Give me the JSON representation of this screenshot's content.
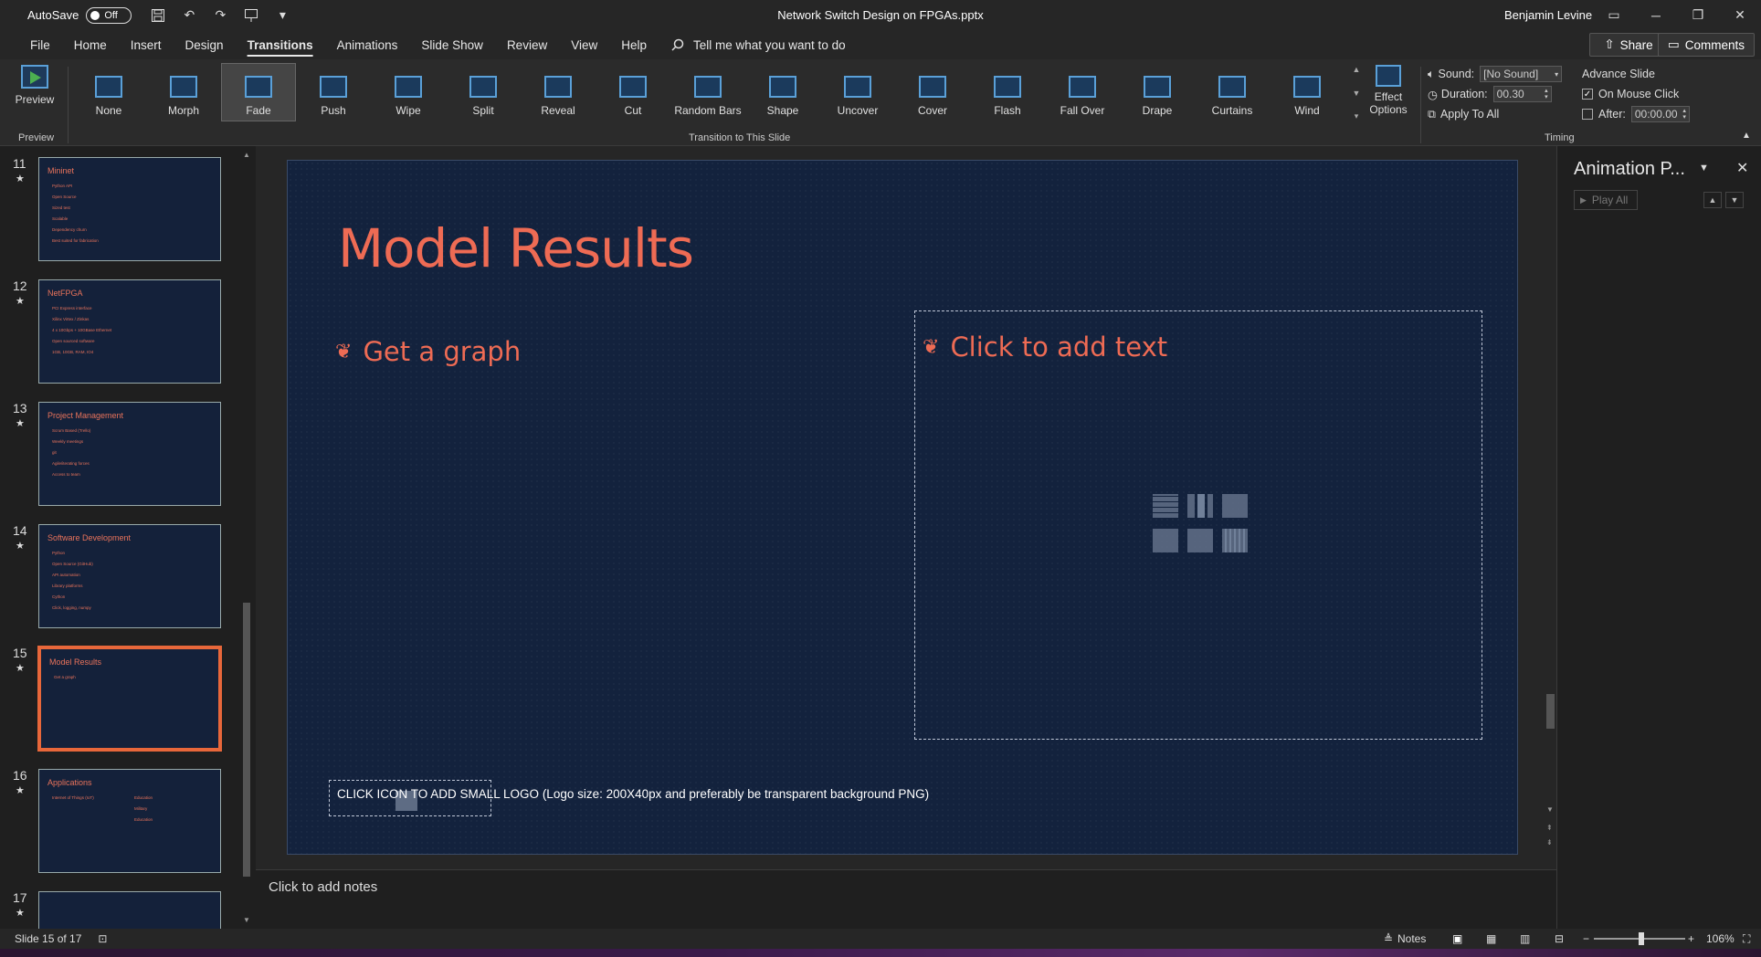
{
  "titlebar": {
    "autosave_label": "AutoSave",
    "autosave_state": "Off",
    "document_title": "Network Switch Design on FPGAs.pptx",
    "user_name": "Benjamin Levine"
  },
  "menu": {
    "items": [
      "File",
      "Home",
      "Insert",
      "Design",
      "Transitions",
      "Animations",
      "Slide Show",
      "Review",
      "View",
      "Help"
    ],
    "active": "Transitions",
    "tell_me": "Tell me what you want to do",
    "share": "Share",
    "comments": "Comments"
  },
  "ribbon": {
    "preview_label": "Preview",
    "preview_group": "Preview",
    "transitions_group": "Transition to This Slide",
    "timing_group": "Timing",
    "transitions": [
      "None",
      "Morph",
      "Fade",
      "Push",
      "Wipe",
      "Split",
      "Reveal",
      "Cut",
      "Random Bars",
      "Shape",
      "Uncover",
      "Cover",
      "Flash",
      "Fall Over",
      "Drape",
      "Curtains",
      "Wind"
    ],
    "selected_transition": "Fade",
    "effect_options": "Effect Options",
    "sound_label": "Sound:",
    "sound_value": "[No Sound]",
    "duration_label": "Duration:",
    "duration_value": "00.30",
    "apply_all": "Apply To All",
    "advance_label": "Advance Slide",
    "on_mouse_click": "On Mouse Click",
    "on_mouse_click_checked": true,
    "after_label": "After:",
    "after_value": "00:00.00",
    "after_checked": false
  },
  "slides": [
    {
      "num": "11",
      "title": "Mininet",
      "bullets": [
        "Python API",
        "Open Source",
        "Sized test",
        "Scalable",
        "Dependency churn",
        "Best suited for fabrication"
      ]
    },
    {
      "num": "12",
      "title": "NetFPGA",
      "bullets": [
        "PCI Express interface",
        "Xilinx Virtex / Zinkas",
        "4 x 10Gbps + 10GBase Ethernet",
        "Open sourced software",
        "1GB, 10GB, RAM, IO4"
      ]
    },
    {
      "num": "13",
      "title": "Project Management",
      "bullets": [
        "Scrum Based (Trello)",
        "Weekly meetings",
        "git",
        "Agile/iterating forces",
        "Access to team"
      ]
    },
    {
      "num": "14",
      "title": "Software Development",
      "bullets": [
        "Python",
        "Open Source (GitHub)",
        "API automation",
        "Library platforms",
        "Cython",
        "Click, logging, numpy"
      ]
    },
    {
      "num": "15",
      "title": "Model Results",
      "bullets": [
        "Get a graph"
      ]
    },
    {
      "num": "16",
      "title": "Applications",
      "bullets": [
        "Internet of Things (IoT)",
        "Education",
        "Military",
        "Education"
      ]
    },
    {
      "num": "17",
      "title": "",
      "bullets": []
    }
  ],
  "selected_slide": "15",
  "current_slide": {
    "title": "Model Results",
    "bullet": "Get a graph",
    "placeholder_text": "Click to add text",
    "logo_text": "CLICK ICON TO ADD SMALL LOGO (Logo size: 200X40px and preferably be transparent background PNG)"
  },
  "notes_placeholder": "Click to add notes",
  "animation_pane": {
    "title": "Animation P...",
    "play_all": "Play All"
  },
  "status": {
    "slide_of": "Slide 15 of 17",
    "notes": "Notes",
    "zoom": "106%"
  },
  "colors": {
    "accent": "#ee6b54",
    "slide_bg": "#13223d",
    "transition_icon": "#5aa0d8"
  }
}
